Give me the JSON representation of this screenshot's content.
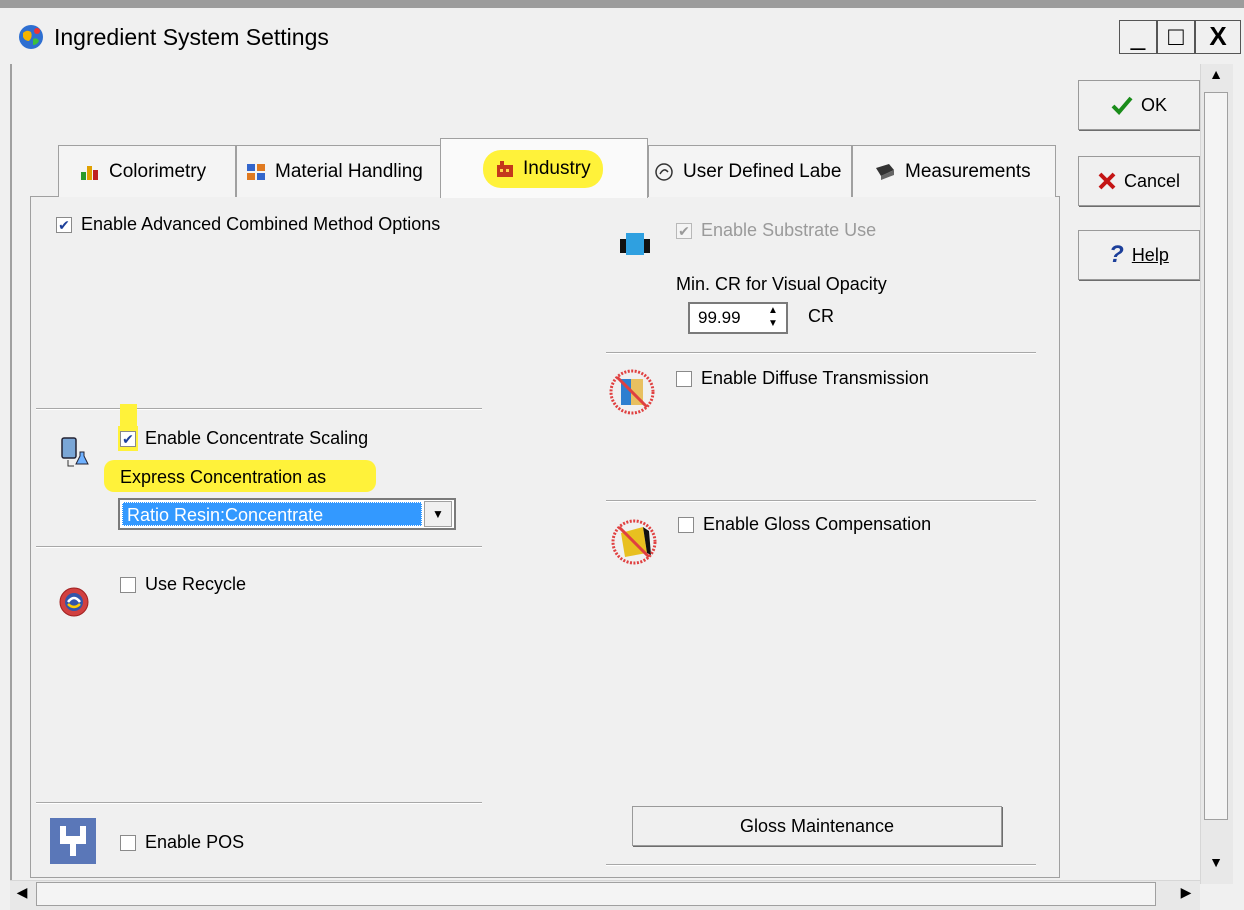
{
  "window": {
    "title": "Ingredient System Settings",
    "minimize": "_",
    "maximize": "□",
    "close": "X"
  },
  "buttons": {
    "ok": "OK",
    "cancel": "Cancel",
    "help": "Help"
  },
  "tabs": [
    {
      "label": "Colorimetry",
      "icon": "colorimetry-icon"
    },
    {
      "label": "Material Handling",
      "icon": "material-handling-icon"
    },
    {
      "label": "Industry",
      "icon": "industry-icon",
      "active": true
    },
    {
      "label": "User Defined Labe",
      "icon": "user-defined-labels-icon"
    },
    {
      "label": "Measurements",
      "icon": "measurements-icon"
    }
  ],
  "industry": {
    "advanced_combined": {
      "label": "Enable Advanced Combined Method Options",
      "checked": true
    },
    "substrate": {
      "label": "Enable Substrate Use",
      "checked": true,
      "disabled": true
    },
    "min_cr": {
      "label": "Min. CR for Visual Opacity",
      "value": "99.99",
      "unit": "CR"
    },
    "diffuse": {
      "label": "Enable Diffuse Transmission",
      "checked": false
    },
    "concentrate_scaling": {
      "label": "Enable Concentrate Scaling",
      "checked": true
    },
    "express_label": "Express Concentration as",
    "express_value": "Ratio Resin:Concentrate",
    "gloss": {
      "label": "Enable Gloss Compensation",
      "checked": false
    },
    "recycle": {
      "label": "Use Recycle",
      "checked": false
    },
    "gloss_maintenance": "Gloss Maintenance",
    "pos": {
      "label": "Enable POS",
      "checked": false
    }
  },
  "colors": {
    "highlight": "#fff23a",
    "selection": "#3399ff"
  }
}
